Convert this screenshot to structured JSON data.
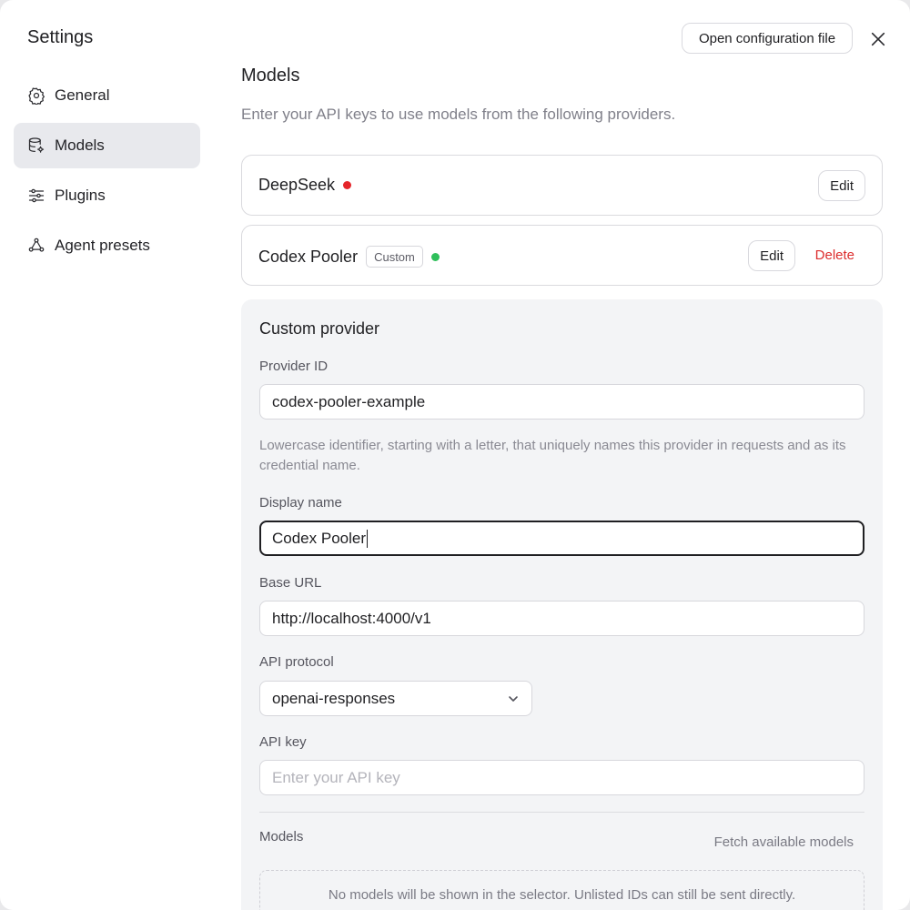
{
  "sidebar": {
    "title": "Settings",
    "items": [
      {
        "label": "General",
        "icon": "gear-icon",
        "active": false
      },
      {
        "label": "Models",
        "icon": "database-settings-icon",
        "active": true
      },
      {
        "label": "Plugins",
        "icon": "sliders-icon",
        "active": false
      },
      {
        "label": "Agent presets",
        "icon": "network-icon",
        "active": false
      }
    ]
  },
  "header": {
    "open_config_label": "Open configuration file",
    "close_icon": "close-icon"
  },
  "main": {
    "title": "Models",
    "description": "Enter your API keys to use models from the following providers.",
    "providers": [
      {
        "name": "DeepSeek",
        "status_color": "#e5252a",
        "edit_label": "Edit"
      },
      {
        "name": "Codex Pooler",
        "badge": "Custom",
        "status_color": "#2fbf5b",
        "edit_label": "Edit",
        "delete_label": "Delete"
      }
    ]
  },
  "form": {
    "title": "Custom provider",
    "provider_id": {
      "label": "Provider ID",
      "value": "codex-pooler-example",
      "help": "Lowercase identifier, starting with a letter, that uniquely names this provider in requests and as its credential name."
    },
    "display_name": {
      "label": "Display name",
      "value": "Codex Pooler"
    },
    "base_url": {
      "label": "Base URL",
      "value": "http://localhost:4000/v1"
    },
    "api_protocol": {
      "label": "API protocol",
      "value": "openai-responses"
    },
    "api_key": {
      "label": "API key",
      "placeholder": "Enter your API key",
      "value": ""
    },
    "models": {
      "label": "Models",
      "fetch_label": "Fetch available models",
      "empty_text": "No models will be shown in the selector. Unlisted IDs can still be sent directly."
    }
  },
  "colors": {
    "accent_danger": "#dc2d2d",
    "active_nav_bg": "#e8e9ed",
    "form_bg": "#f3f4f6"
  }
}
